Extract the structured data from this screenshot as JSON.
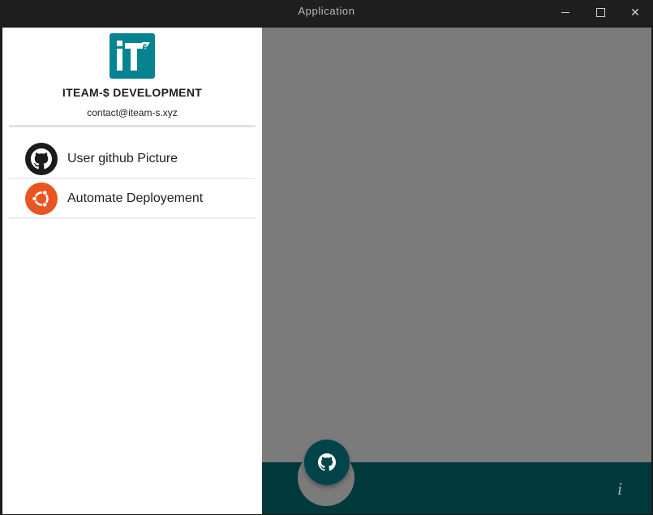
{
  "window": {
    "title": "Application",
    "minimize_label": "—",
    "maximize_label": "",
    "close_label": "✕"
  },
  "drawer": {
    "logo_icon": "iteam-s-logo",
    "brand": "ITEAM-$ DEVELOPMENT",
    "email": "contact@iteam-s.xyz",
    "items": [
      {
        "label": "User github Picture",
        "icon": "github-icon"
      },
      {
        "label": "Automate Deployement",
        "icon": "ubuntu-icon"
      }
    ]
  },
  "bottom_bar": {
    "fab_icon": "github-icon",
    "info_icon": "i"
  },
  "colors": {
    "accent": "#00393c",
    "logo": "#058391",
    "ubuntu": "#e95420",
    "scrim": "#7b7b7b"
  }
}
